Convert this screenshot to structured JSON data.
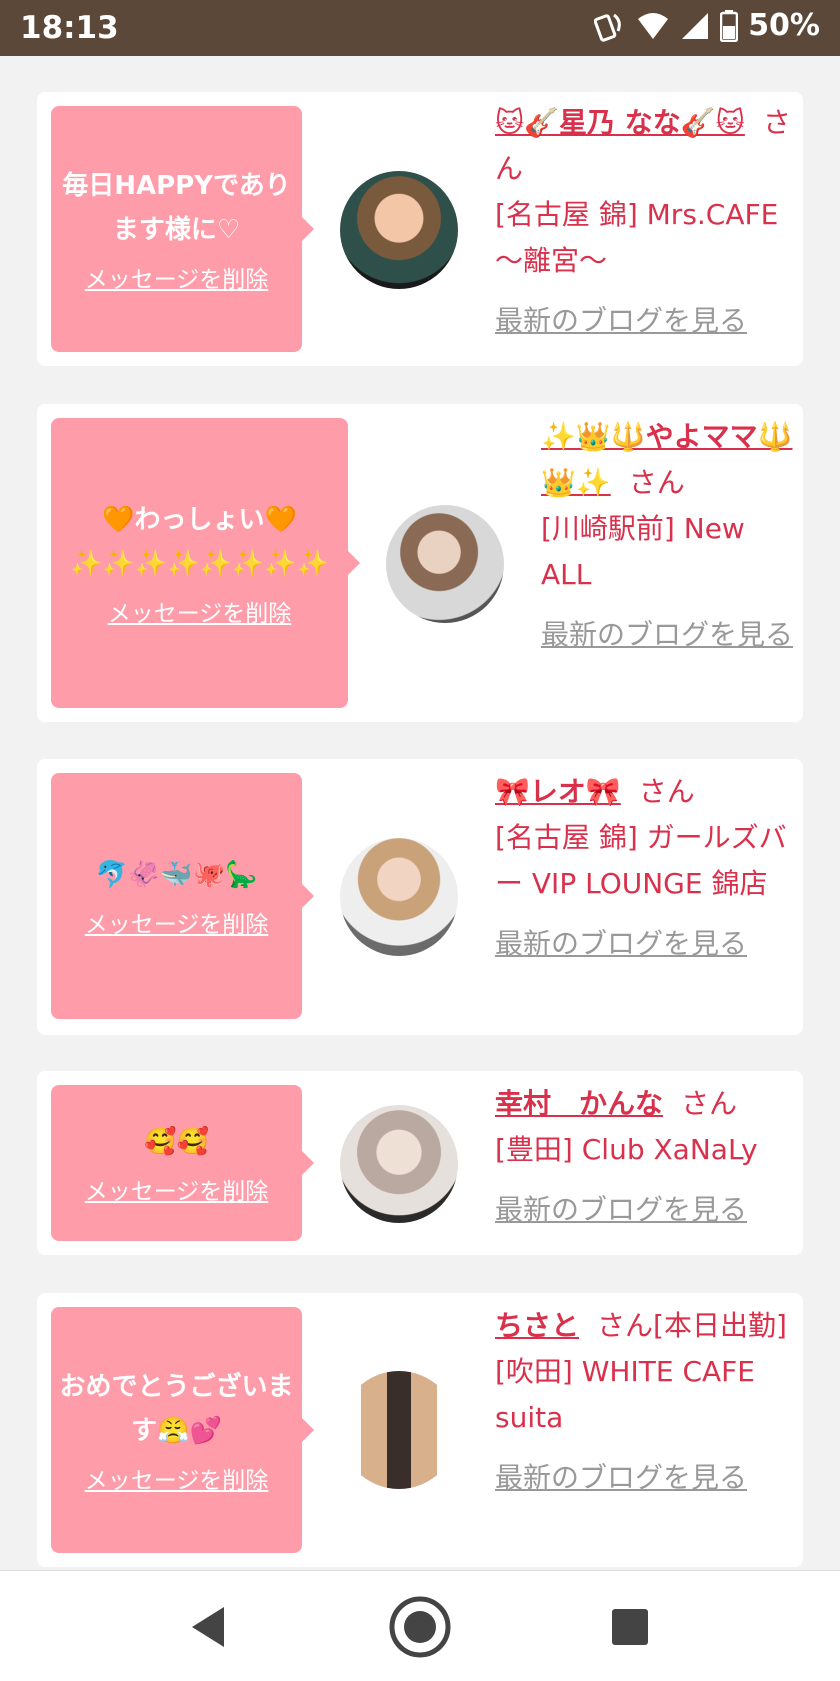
{
  "status_bar": {
    "time": "18:13",
    "battery": "50%"
  },
  "cards": [
    {
      "message": "毎日HAPPYであります様に♡",
      "delete_label": "メッセージを削除",
      "name": "🐱🎸星乃 なな🎸🐱",
      "honorific": "さん",
      "shop": "[名古屋 錦] Mrs.CAFE 〜離宮〜",
      "blog_label": "最新のブログを見る"
    },
    {
      "message": "🧡わっしょい🧡✨✨✨✨✨✨✨✨",
      "delete_label": "メッセージを削除",
      "name": "✨👑🔱やよママ🔱👑✨",
      "honorific": "さん",
      "shop": "[川崎駅前] New ALL",
      "blog_label": "最新のブログを見る"
    },
    {
      "message": "🐬🦑🐳🐙🦕",
      "delete_label": "メッセージを削除",
      "name": "🎀レオ🎀",
      "honorific": "さん",
      "shop": "[名古屋 錦] ガールズバー VIP LOUNGE 錦店",
      "blog_label": "最新のブログを見る"
    },
    {
      "message": "🥰🥰",
      "delete_label": "メッセージを削除",
      "name": "幸村　かんな",
      "honorific": "さん",
      "shop": "[豊田] Club XaNaLy",
      "blog_label": "最新のブログを見る"
    },
    {
      "message": "おめでとうございます😤💕",
      "delete_label": "メッセージを削除",
      "name": "ちさと",
      "honorific": "さん[本日出勤]",
      "shop": "[吹田] WHITE CAFE suita",
      "blog_label": "最新のブログを見る"
    }
  ],
  "colors": {
    "status_bar": "#5b4838",
    "bubble": "#ff9caa",
    "accent": "#d9314c",
    "link_gray": "#999999"
  }
}
